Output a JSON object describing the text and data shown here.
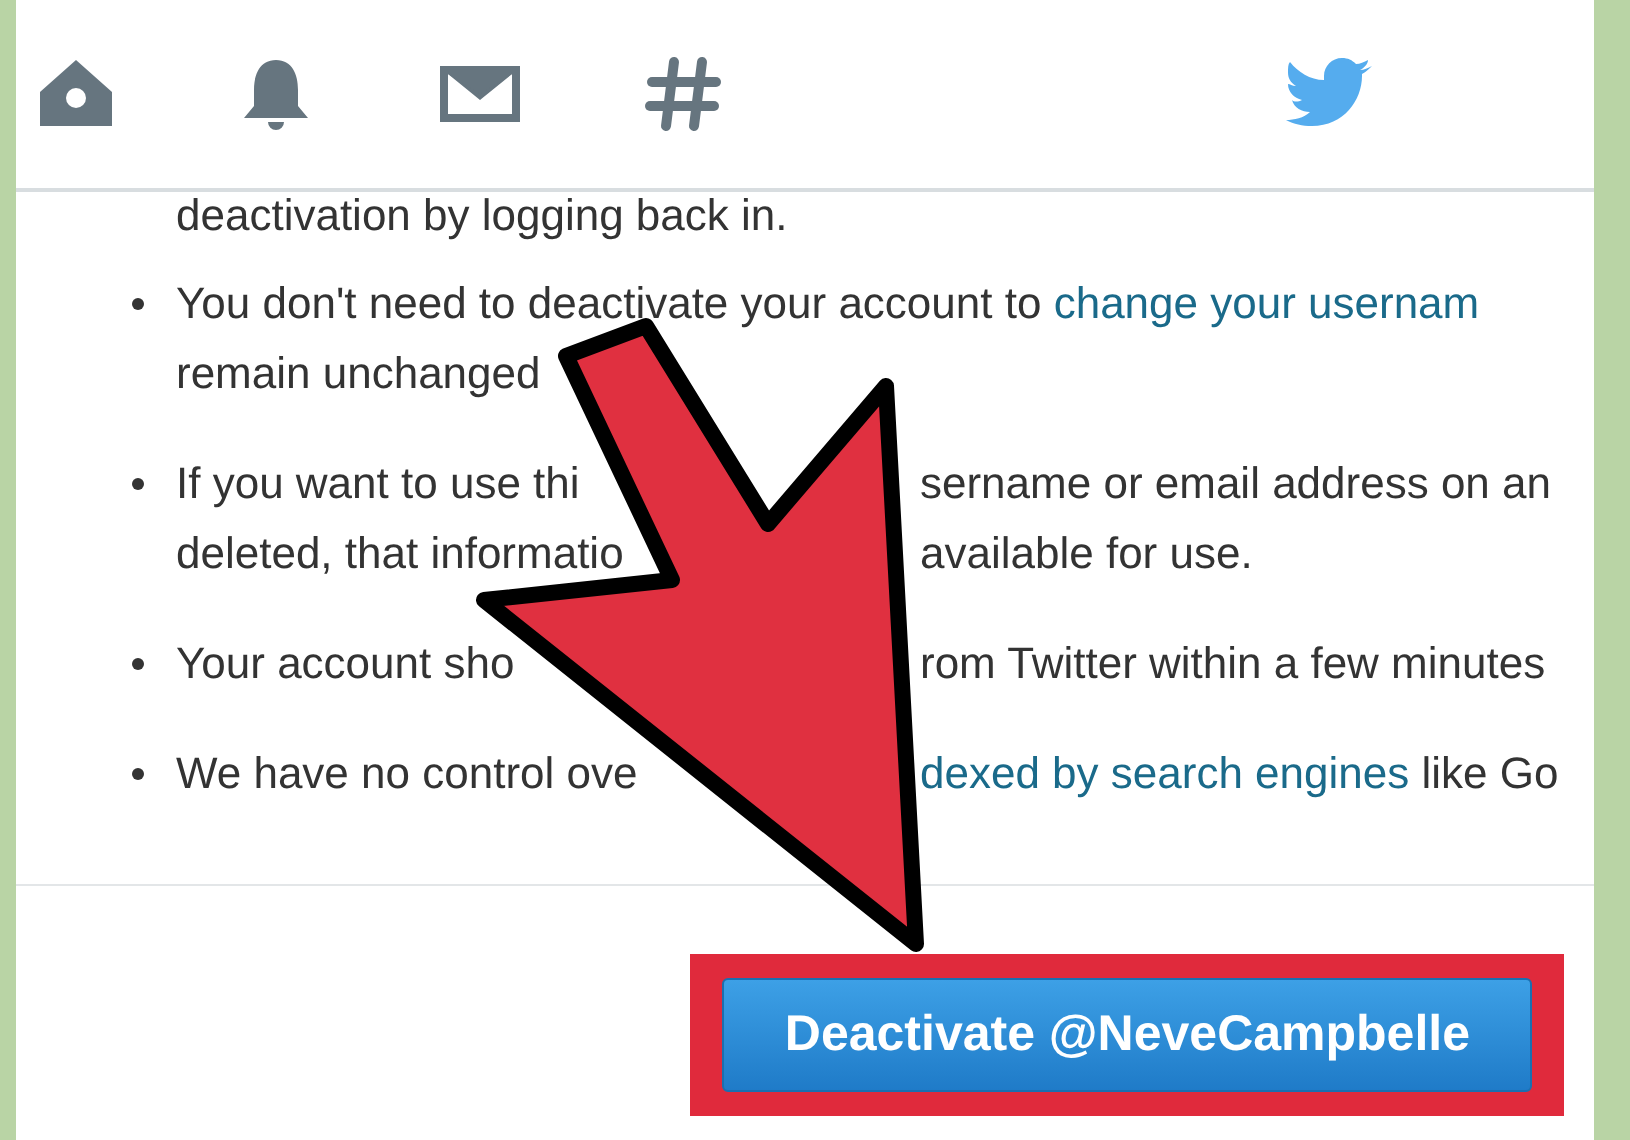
{
  "intro": "deactivation by logging back in.",
  "bullets": [
    {
      "lines": [
        [
          {
            "kind": "text",
            "text": "You don't need to deactivate your account to "
          },
          {
            "kind": "link",
            "text": "change your usernam"
          }
        ],
        [
          {
            "kind": "text",
            "text": "remain unchanged"
          }
        ]
      ]
    },
    {
      "lines": [
        [
          {
            "kind": "text",
            "text": "If you want to use thi"
          },
          {
            "kind": "text",
            "text": "sername or email address on an",
            "gap_before": true
          }
        ],
        [
          {
            "kind": "text",
            "text": "deleted, that informatio"
          },
          {
            "kind": "text",
            "text": "available for use.",
            "gap_before": true
          }
        ]
      ]
    },
    {
      "lines": [
        [
          {
            "kind": "text",
            "text": "Your account sho"
          },
          {
            "kind": "text",
            "text": "rom Twitter within a few minutes",
            "gap_before": true
          }
        ]
      ]
    },
    {
      "lines": [
        [
          {
            "kind": "text",
            "text": "We have no control ove"
          },
          {
            "kind": "link",
            "text": "dexed by search engines",
            "gap_before": true
          },
          {
            "kind": "text",
            "text": " like Go"
          }
        ]
      ]
    }
  ],
  "button": "Deactivate @NeveCampbelle"
}
